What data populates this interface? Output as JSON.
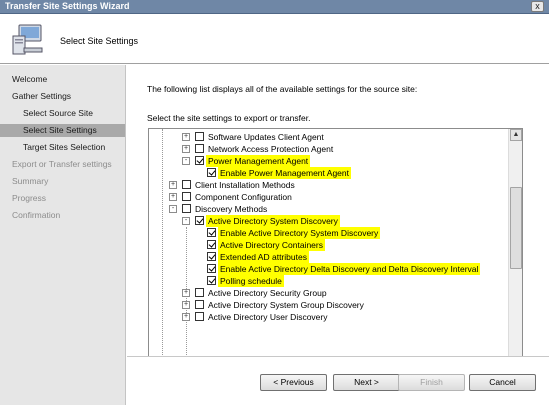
{
  "window": {
    "title": "Transfer Site Settings Wizard",
    "close_glyph": "x"
  },
  "header": {
    "title": "Select Site Settings",
    "icon": "computer-wizard-icon"
  },
  "sidebar": {
    "items": [
      {
        "label": "Welcome",
        "state": "normal"
      },
      {
        "label": "Gather Settings",
        "state": "normal"
      },
      {
        "label": "Select Source Site",
        "state": "normal"
      },
      {
        "label": "Select Site Settings",
        "state": "selected"
      },
      {
        "label": "Target Sites Selection",
        "state": "normal"
      },
      {
        "label": "Export or Transfer settings",
        "state": "disabled"
      },
      {
        "label": "Summary",
        "state": "disabled"
      },
      {
        "label": "Progress",
        "state": "disabled"
      },
      {
        "label": "Confirmation",
        "state": "disabled"
      }
    ]
  },
  "main": {
    "description": "The following list displays all of the available settings for the source site:",
    "prompt": "Select the site settings to export or transfer."
  },
  "tree": {
    "rows": [
      {
        "label": "Software Updates Client Agent",
        "checked": false,
        "expander": "+",
        "highlight": false
      },
      {
        "label": "Network Access Protection Agent",
        "checked": false,
        "expander": "+",
        "highlight": false
      },
      {
        "label": "Power Management Agent",
        "checked": true,
        "expander": "-",
        "highlight": true
      },
      {
        "label": "Enable Power Management Agent",
        "checked": true,
        "expander": "",
        "highlight": true
      },
      {
        "label": "Client Installation Methods",
        "checked": false,
        "expander": "+",
        "highlight": false
      },
      {
        "label": "Component Configuration",
        "checked": false,
        "expander": "+",
        "highlight": false
      },
      {
        "label": "Discovery Methods",
        "checked": false,
        "expander": "-",
        "highlight": false
      },
      {
        "label": "Active Directory System Discovery",
        "checked": true,
        "expander": "-",
        "highlight": true
      },
      {
        "label": "Enable Active Directory System Discovery",
        "checked": true,
        "expander": "",
        "highlight": true
      },
      {
        "label": "Active Directory Containers",
        "checked": true,
        "expander": "",
        "highlight": true
      },
      {
        "label": "Extended AD attributes",
        "checked": true,
        "expander": "",
        "highlight": true
      },
      {
        "label": "Enable Active Directory Delta Discovery and Delta Discovery Interval",
        "checked": true,
        "expander": "",
        "highlight": true
      },
      {
        "label": "Polling schedule",
        "checked": true,
        "expander": "",
        "highlight": true
      },
      {
        "label": "Active Directory Security Group",
        "checked": false,
        "expander": "+",
        "highlight": false
      },
      {
        "label": "Active Directory System Group Discovery",
        "checked": false,
        "expander": "+",
        "highlight": false
      },
      {
        "label": "Active Directory User Discovery",
        "checked": false,
        "expander": "+",
        "highlight": false
      }
    ],
    "scroll_up_glyph": "▲",
    "scroll_down_glyph": "▼"
  },
  "buttons": {
    "previous": "< Previous",
    "next": "Next >",
    "finish": "Finish",
    "cancel": "Cancel"
  },
  "colors": {
    "titlebar": "#6f87a6",
    "highlight": "#ffff00",
    "sidebar_bg": "#e6e6e6",
    "sidebar_selected": "#a9a9a9"
  }
}
